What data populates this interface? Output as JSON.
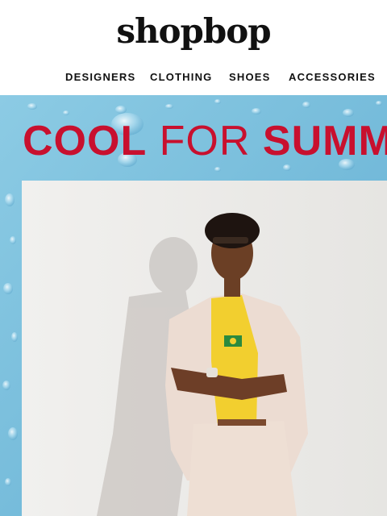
{
  "brand": {
    "logo_text": "shopbop"
  },
  "nav": {
    "items": [
      {
        "label": "DESIGNERS"
      },
      {
        "label": "CLOTHING"
      },
      {
        "label": "SHOES"
      },
      {
        "label": "ACCESSORIES"
      }
    ]
  },
  "hero": {
    "headline": {
      "word1": "COOL",
      "word2": "FOR",
      "word3": "SUMM"
    },
    "colors": {
      "headline": "#c8102e",
      "background": "#7cbfdc",
      "backdrop": "#ebebe9"
    }
  }
}
